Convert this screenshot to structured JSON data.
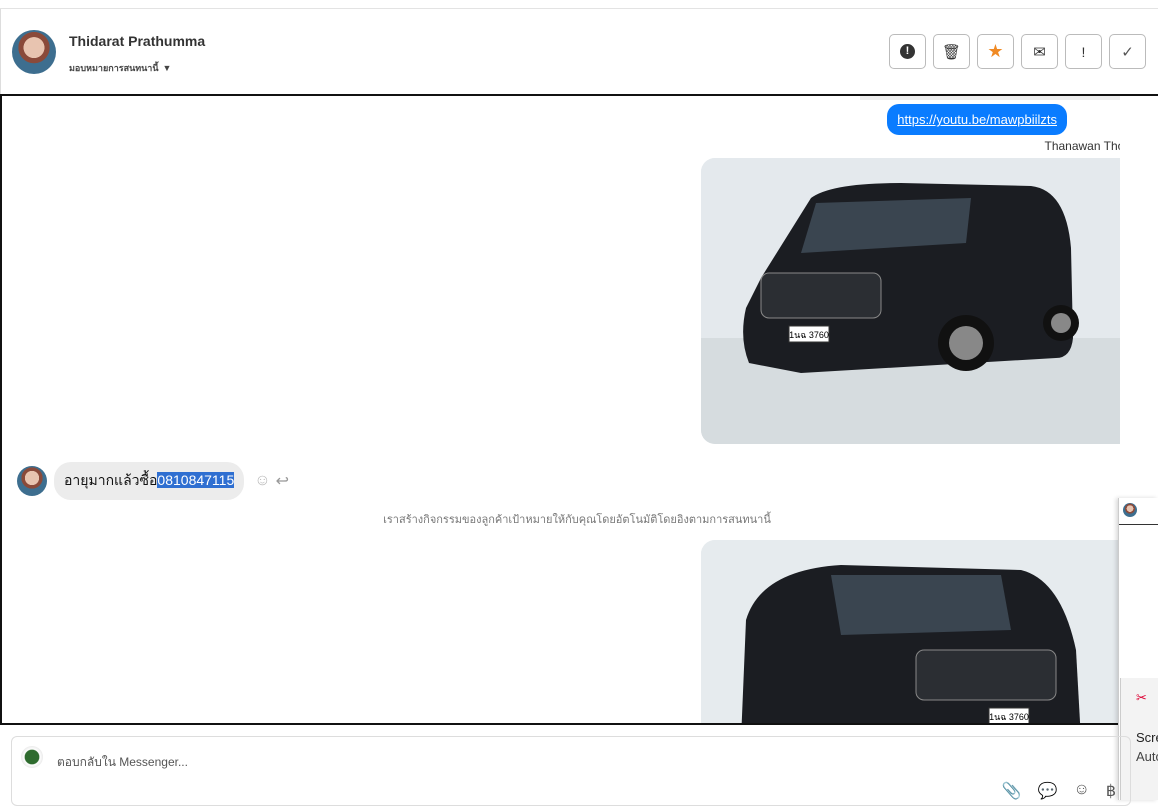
{
  "header": {
    "name": "Thidarat Prathumma",
    "assign_label": "มอบหมายการสนทนานี้"
  },
  "toolbar": [
    {
      "name": "spam",
      "glyph": "❗"
    },
    {
      "name": "delete",
      "glyph": "🗑"
    },
    {
      "name": "star",
      "glyph": "★"
    },
    {
      "name": "mail",
      "glyph": "✉"
    },
    {
      "name": "important",
      "glyph": "!"
    },
    {
      "name": "done",
      "glyph": "✓"
    }
  ],
  "messages": {
    "link": "https://youtu.be/mawpbiilzts",
    "sender": "Thanawan Thon",
    "incoming_text": "อายุมากแล้วซื้อ",
    "incoming_selected": "0810847115",
    "system_note": "เราสร้างกิจกรรมของลูกค้าเป้าหมายให้กับคุณโดยอัตโนมัติโดยอิงตามการสนทนานี้",
    "plate": "1นฉ 3760"
  },
  "composer": {
    "placeholder": "ตอบกลับใน Messenger..."
  },
  "overlay": {
    "line1": "Scre",
    "line2": "Auto"
  },
  "colors": {
    "accent": "#0a7cff",
    "star": "#f08a24",
    "selection": "#2f6fd1"
  }
}
